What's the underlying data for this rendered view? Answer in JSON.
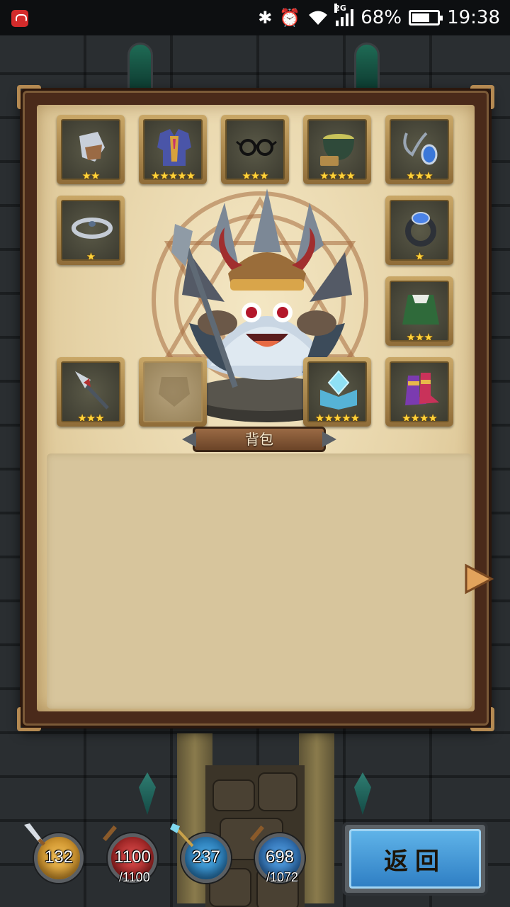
{
  "status_bar": {
    "bluetooth_icon": "bluetooth-icon",
    "alarm_icon": "alarm-icon",
    "wifi_icon": "wifi-icon",
    "network": "2G",
    "battery": "68%",
    "time": "19:38"
  },
  "equipment_slots": [
    {
      "name": "gauntlets",
      "icon": "gauntlet-icon",
      "stars": "★★"
    },
    {
      "name": "chest-armor",
      "icon": "armor-icon",
      "stars": "★★★★★"
    },
    {
      "name": "glasses",
      "icon": "glasses-icon",
      "stars": "★★★"
    },
    {
      "name": "cauldron",
      "icon": "cauldron-icon",
      "stars": "★★★★"
    },
    {
      "name": "amulet",
      "icon": "amulet-icon",
      "stars": "★★★"
    },
    {
      "name": "circlet",
      "icon": "circlet-icon",
      "stars": "★"
    },
    {
      "name": "ring",
      "icon": "ring-icon",
      "stars": "★"
    },
    {
      "name": "cloak",
      "icon": "cloak-icon",
      "stars": "★★★"
    },
    {
      "name": "spear",
      "icon": "spear-icon",
      "stars": "★★★"
    },
    {
      "name": "empty",
      "icon": "empty-slot-icon",
      "stars": ""
    },
    {
      "name": "spellbook",
      "icon": "spellbook-icon",
      "stars": "★★★★★"
    },
    {
      "name": "boots",
      "icon": "boots-icon",
      "stars": "★★★★"
    }
  ],
  "backpack": {
    "label": "背包"
  },
  "stats": {
    "attack": {
      "value": "132"
    },
    "hp": {
      "value": "1100",
      "max": "/1100"
    },
    "magic": {
      "value": "237"
    },
    "mana": {
      "value": "698",
      "max": "/1072"
    }
  },
  "return_button": {
    "label": "返回"
  },
  "colors": {
    "parchment": "#e6d3a7",
    "frame": "#4a2a1a",
    "star": "#ffd33a",
    "attack_orb": "#e0a02a",
    "hp_orb": "#c42a2a",
    "magic_orb": "#2a86c8",
    "mana_orb": "#2a6fb8",
    "return_button": "#3f94d6"
  }
}
